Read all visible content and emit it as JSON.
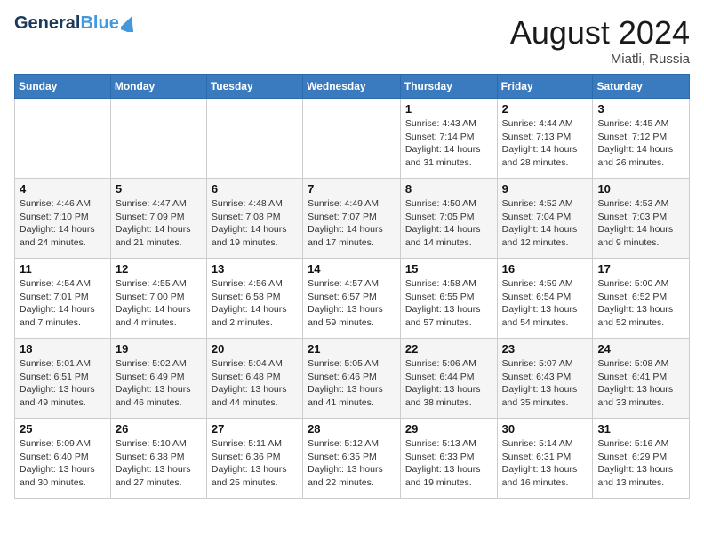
{
  "logo": {
    "general": "General",
    "blue": "Blue"
  },
  "title": "August 2024",
  "location": "Miatli, Russia",
  "days_of_week": [
    "Sunday",
    "Monday",
    "Tuesday",
    "Wednesday",
    "Thursday",
    "Friday",
    "Saturday"
  ],
  "weeks": [
    [
      {
        "day": "",
        "info": ""
      },
      {
        "day": "",
        "info": ""
      },
      {
        "day": "",
        "info": ""
      },
      {
        "day": "",
        "info": ""
      },
      {
        "day": "1",
        "info": "Sunrise: 4:43 AM\nSunset: 7:14 PM\nDaylight: 14 hours\nand 31 minutes."
      },
      {
        "day": "2",
        "info": "Sunrise: 4:44 AM\nSunset: 7:13 PM\nDaylight: 14 hours\nand 28 minutes."
      },
      {
        "day": "3",
        "info": "Sunrise: 4:45 AM\nSunset: 7:12 PM\nDaylight: 14 hours\nand 26 minutes."
      }
    ],
    [
      {
        "day": "4",
        "info": "Sunrise: 4:46 AM\nSunset: 7:10 PM\nDaylight: 14 hours\nand 24 minutes."
      },
      {
        "day": "5",
        "info": "Sunrise: 4:47 AM\nSunset: 7:09 PM\nDaylight: 14 hours\nand 21 minutes."
      },
      {
        "day": "6",
        "info": "Sunrise: 4:48 AM\nSunset: 7:08 PM\nDaylight: 14 hours\nand 19 minutes."
      },
      {
        "day": "7",
        "info": "Sunrise: 4:49 AM\nSunset: 7:07 PM\nDaylight: 14 hours\nand 17 minutes."
      },
      {
        "day": "8",
        "info": "Sunrise: 4:50 AM\nSunset: 7:05 PM\nDaylight: 14 hours\nand 14 minutes."
      },
      {
        "day": "9",
        "info": "Sunrise: 4:52 AM\nSunset: 7:04 PM\nDaylight: 14 hours\nand 12 minutes."
      },
      {
        "day": "10",
        "info": "Sunrise: 4:53 AM\nSunset: 7:03 PM\nDaylight: 14 hours\nand 9 minutes."
      }
    ],
    [
      {
        "day": "11",
        "info": "Sunrise: 4:54 AM\nSunset: 7:01 PM\nDaylight: 14 hours\nand 7 minutes."
      },
      {
        "day": "12",
        "info": "Sunrise: 4:55 AM\nSunset: 7:00 PM\nDaylight: 14 hours\nand 4 minutes."
      },
      {
        "day": "13",
        "info": "Sunrise: 4:56 AM\nSunset: 6:58 PM\nDaylight: 14 hours\nand 2 minutes."
      },
      {
        "day": "14",
        "info": "Sunrise: 4:57 AM\nSunset: 6:57 PM\nDaylight: 13 hours\nand 59 minutes."
      },
      {
        "day": "15",
        "info": "Sunrise: 4:58 AM\nSunset: 6:55 PM\nDaylight: 13 hours\nand 57 minutes."
      },
      {
        "day": "16",
        "info": "Sunrise: 4:59 AM\nSunset: 6:54 PM\nDaylight: 13 hours\nand 54 minutes."
      },
      {
        "day": "17",
        "info": "Sunrise: 5:00 AM\nSunset: 6:52 PM\nDaylight: 13 hours\nand 52 minutes."
      }
    ],
    [
      {
        "day": "18",
        "info": "Sunrise: 5:01 AM\nSunset: 6:51 PM\nDaylight: 13 hours\nand 49 minutes."
      },
      {
        "day": "19",
        "info": "Sunrise: 5:02 AM\nSunset: 6:49 PM\nDaylight: 13 hours\nand 46 minutes."
      },
      {
        "day": "20",
        "info": "Sunrise: 5:04 AM\nSunset: 6:48 PM\nDaylight: 13 hours\nand 44 minutes."
      },
      {
        "day": "21",
        "info": "Sunrise: 5:05 AM\nSunset: 6:46 PM\nDaylight: 13 hours\nand 41 minutes."
      },
      {
        "day": "22",
        "info": "Sunrise: 5:06 AM\nSunset: 6:44 PM\nDaylight: 13 hours\nand 38 minutes."
      },
      {
        "day": "23",
        "info": "Sunrise: 5:07 AM\nSunset: 6:43 PM\nDaylight: 13 hours\nand 35 minutes."
      },
      {
        "day": "24",
        "info": "Sunrise: 5:08 AM\nSunset: 6:41 PM\nDaylight: 13 hours\nand 33 minutes."
      }
    ],
    [
      {
        "day": "25",
        "info": "Sunrise: 5:09 AM\nSunset: 6:40 PM\nDaylight: 13 hours\nand 30 minutes."
      },
      {
        "day": "26",
        "info": "Sunrise: 5:10 AM\nSunset: 6:38 PM\nDaylight: 13 hours\nand 27 minutes."
      },
      {
        "day": "27",
        "info": "Sunrise: 5:11 AM\nSunset: 6:36 PM\nDaylight: 13 hours\nand 25 minutes."
      },
      {
        "day": "28",
        "info": "Sunrise: 5:12 AM\nSunset: 6:35 PM\nDaylight: 13 hours\nand 22 minutes."
      },
      {
        "day": "29",
        "info": "Sunrise: 5:13 AM\nSunset: 6:33 PM\nDaylight: 13 hours\nand 19 minutes."
      },
      {
        "day": "30",
        "info": "Sunrise: 5:14 AM\nSunset: 6:31 PM\nDaylight: 13 hours\nand 16 minutes."
      },
      {
        "day": "31",
        "info": "Sunrise: 5:16 AM\nSunset: 6:29 PM\nDaylight: 13 hours\nand 13 minutes."
      }
    ]
  ]
}
